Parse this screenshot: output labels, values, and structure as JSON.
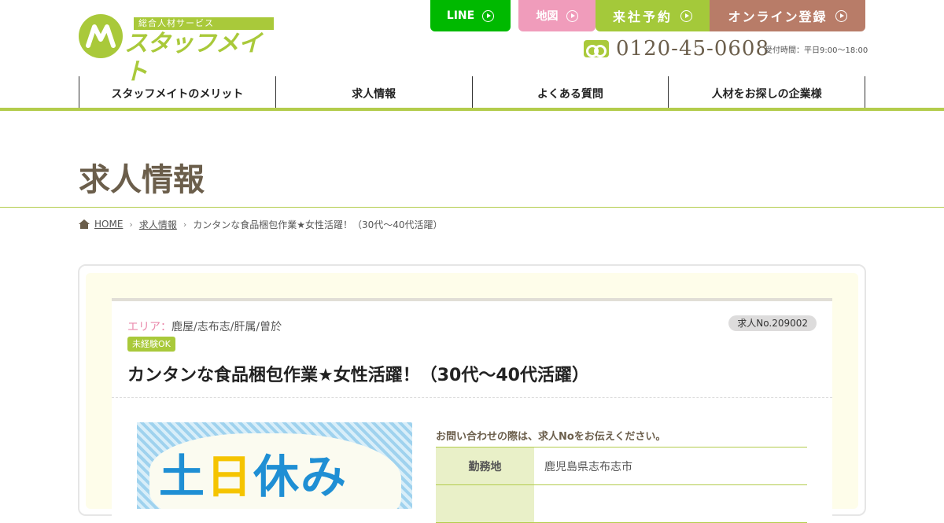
{
  "header": {
    "logo_tagline": "総合人材サービス",
    "logo_name": "スタッフメイト",
    "buttons": {
      "line": "LINE",
      "map": "地図",
      "visit": "来社予約",
      "online": "オンライン登録"
    },
    "tel": "0120-45-0608",
    "hours": "受付時間：平日9:00～18:00"
  },
  "nav": [
    "スタッフメイトのメリット",
    "求人情報",
    "よくある質問",
    "人材をお探しの企業様"
  ],
  "page_title": "求人情報",
  "breadcrumb": {
    "home": "HOME",
    "section": "求人情報",
    "current": "カンタンな食品梱包作業★女性活躍！（30代～40代活躍）"
  },
  "job": {
    "area_label": "エリア：",
    "area_value": "鹿屋/志布志/肝属/曽於",
    "job_no": "求人No.209002",
    "badge": "未経験OK",
    "title": "カンタンな食品梱包作業★女性活躍！（30代～40代活躍）",
    "image_text_a": "土",
    "image_text_b": "日",
    "image_text_c": "休み",
    "inquiry_note": "お問い合わせの際は、求人Noをお伝えください。",
    "details": [
      {
        "label": "勤務地",
        "value": "鹿児島県志布志市"
      },
      {
        "label": "",
        "value": ""
      }
    ]
  },
  "colors": {
    "brand_green": "#a9c93a",
    "line_green": "#00b900",
    "pink": "#f09cbb",
    "brown": "#b87c68",
    "text_brown": "#6b5e4b"
  }
}
